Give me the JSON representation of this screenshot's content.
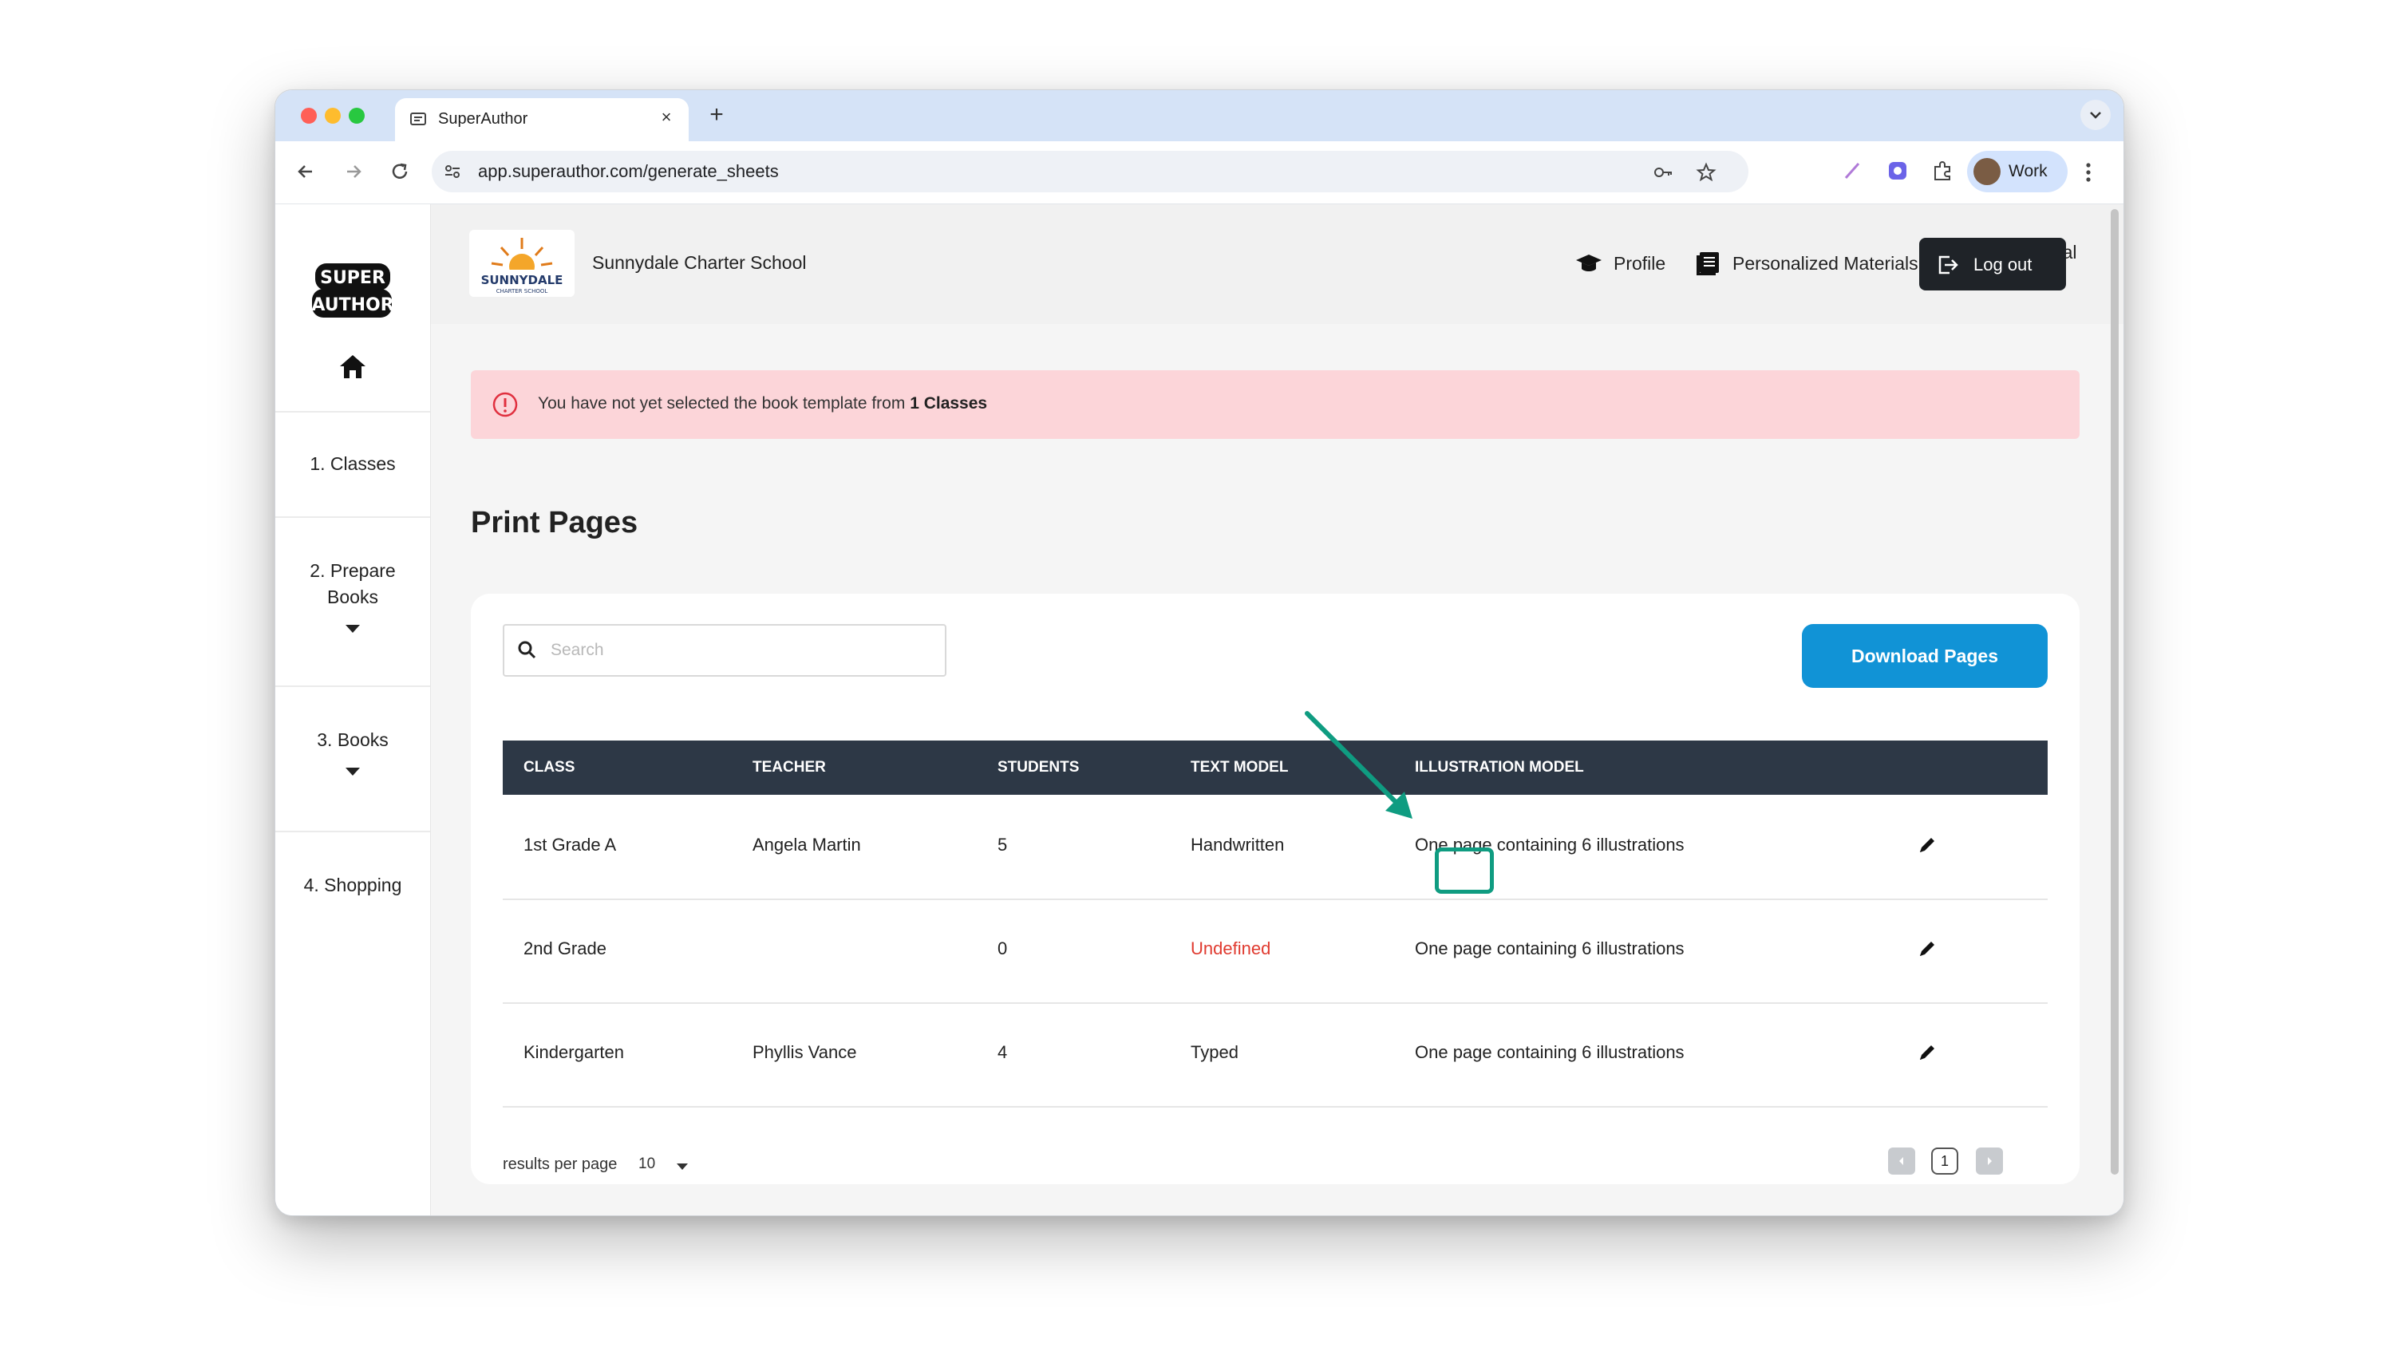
{
  "browser": {
    "tab_title": "SuperAuthor",
    "tab_close": "×",
    "new_tab": "+",
    "url": "app.superauthor.com/generate_sheets",
    "profile_label": "Work"
  },
  "app": {
    "logo_text": "SUPER AUTHOR",
    "school_name": "Sunnydale Charter School",
    "school_logo_text": "SUNNYDALE",
    "school_logo_subtext": "CHARTER SCHOOL",
    "nav": {
      "profile": "Profile",
      "materials": "Personalized Materials",
      "resources": "Pedagogical Resources",
      "logout": "Log out"
    }
  },
  "sidebar": {
    "items": [
      {
        "label": "1. Classes"
      },
      {
        "label": "2. Prepare Books"
      },
      {
        "label": "3. Books"
      },
      {
        "label": "4. Shopping"
      }
    ]
  },
  "alert": {
    "text": "You have not yet selected the book template from ",
    "highlight": "1 Classes"
  },
  "page_title": "Print Pages",
  "search": {
    "placeholder": "Search"
  },
  "download_button": "Download Pages",
  "table": {
    "headers": [
      "CLASS",
      "TEACHER",
      "STUDENTS",
      "TEXT MODEL",
      "ILLUSTRATION MODEL"
    ],
    "rows": [
      {
        "class": "1st Grade A",
        "teacher": "Angela Martin",
        "students": "5",
        "text_model": "Handwritten",
        "illustration_model": "One page containing 6 illustrations"
      },
      {
        "class": "2nd Grade",
        "teacher": "",
        "students": "0",
        "text_model": "Undefined",
        "illustration_model": "One page containing 6 illustrations"
      },
      {
        "class": "Kindergarten",
        "teacher": "Phyllis Vance",
        "students": "4",
        "text_model": "Typed",
        "illustration_model": "One page containing 6 illustrations"
      }
    ]
  },
  "pagination": {
    "results_label": "results per page",
    "per_page": "10",
    "current_page": "1"
  },
  "colors": {
    "primary_button": "#1193d6",
    "table_header": "#2d3846",
    "alert_bg": "#fcd5d9",
    "error_text": "#e03a2f",
    "annotation": "#0f9c81"
  },
  "icons": [
    "home-icon",
    "graduation-cap-icon",
    "book-icon",
    "teacher-board-icon",
    "logout-icon",
    "alert-circle-icon",
    "search-icon",
    "pencil-icon",
    "chevron-left-icon",
    "chevron-right-icon"
  ]
}
